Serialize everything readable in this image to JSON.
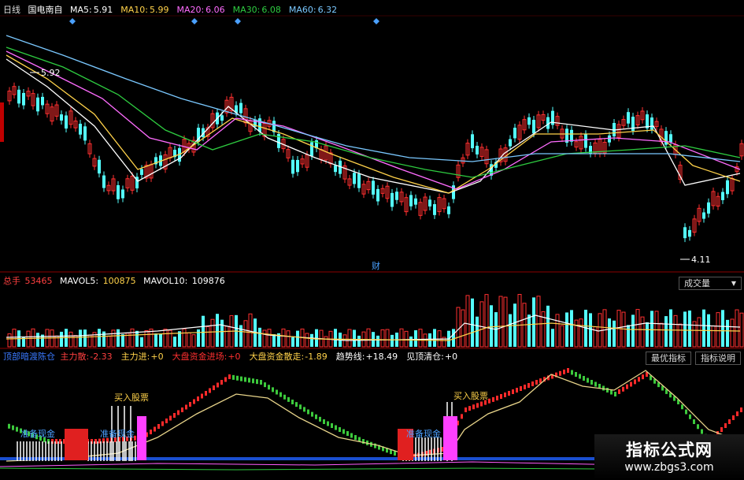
{
  "colors": {
    "up": "#ff3030",
    "down": "#54ffff",
    "ma5": "#ffffff",
    "ma10": "#ffd24a",
    "ma20": "#ff6cff",
    "ma30": "#2ecc40",
    "ma60": "#7ac8ff",
    "frame": "#8b0000"
  },
  "main": {
    "period": "日线",
    "stock": "国电南自",
    "ma": [
      {
        "label": "MA5:",
        "value": "5.91",
        "color": "#ffffff"
      },
      {
        "label": "MA10:",
        "value": "5.99",
        "color": "#ffd24a"
      },
      {
        "label": "MA20:",
        "value": "6.06",
        "color": "#ff6cff"
      },
      {
        "label": "MA30:",
        "value": "6.08",
        "color": "#2ecc40"
      },
      {
        "label": "MA60:",
        "value": "6.32",
        "color": "#7ac8ff"
      }
    ],
    "high_label": "5.92",
    "low_label": "4.11",
    "fin_marker": "财"
  },
  "volume": {
    "label": "总手",
    "value": "53465",
    "mavol5_label": "MAVOL5:",
    "mavol5": "100875",
    "mavol10_label": "MAVOL10:",
    "mavol10": "109876",
    "selector": "成交量"
  },
  "indicator": {
    "title": "顶部暗渡陈仓",
    "items": [
      {
        "label": "主力散:",
        "value": "-2.33",
        "color": "#ff4040"
      },
      {
        "label": "主力进:",
        "value": "+0",
        "color": "#ffd24a"
      },
      {
        "label": "大盘资金进场:",
        "value": "+0",
        "color": "#ff3030"
      },
      {
        "label": "大盘资金散走:",
        "value": "-1.89",
        "color": "#ffd24a"
      },
      {
        "label": "趋势线:",
        "value": "+18.49",
        "color": "#ffffff"
      },
      {
        "label": "见顶清仓:",
        "value": "+0",
        "color": "#ffffff"
      }
    ],
    "btn_best": "最优指标",
    "btn_help": "指标说明",
    "buy_text": "买入股票",
    "prep_text": "准备现金"
  },
  "watermark": {
    "line1": "指标公式网",
    "line2": "www.zbgs3.com"
  }
}
